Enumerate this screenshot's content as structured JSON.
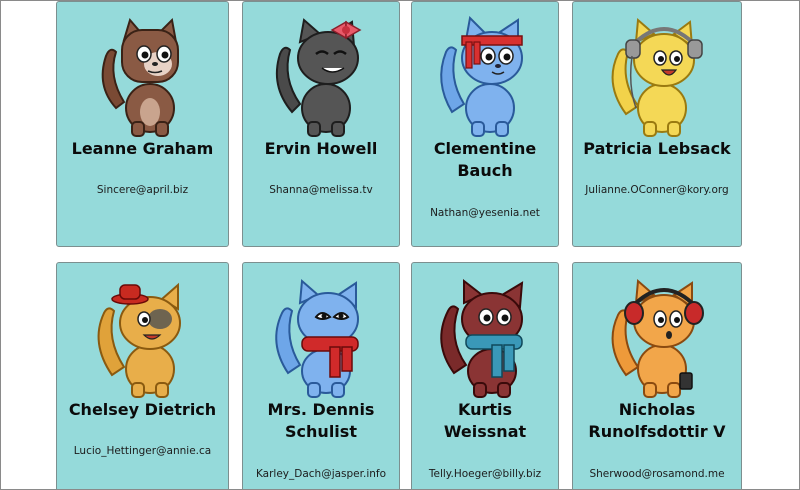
{
  "users": [
    {
      "name": "Leanne Graham",
      "email": "Sincere@april.biz",
      "avatar": "cat-brown-icon"
    },
    {
      "name": "Ervin Howell",
      "email": "Shanna@melissa.tv",
      "avatar": "cat-gray-bow-icon"
    },
    {
      "name": "Clementine Bauch",
      "email": "Nathan@yesenia.net",
      "avatar": "cat-blue-headband-icon"
    },
    {
      "name": "Patricia Lebsack",
      "email": "Julianne.OConner@kory.org",
      "avatar": "cat-yellow-headphones-icon"
    },
    {
      "name": "Chelsey Dietrich",
      "email": "Lucio_Hettinger@annie.ca",
      "avatar": "cat-orange-hat-icon"
    },
    {
      "name": "Mrs. Dennis Schulist",
      "email": "Karley_Dach@jasper.info",
      "avatar": "cat-blue-scarf-icon"
    },
    {
      "name": "Kurtis Weissnat",
      "email": "Telly.Hoeger@billy.biz",
      "avatar": "cat-maroon-scarf-icon"
    },
    {
      "name": "Nicholas Runolfsdottir V",
      "email": "Sherwood@rosamond.me",
      "avatar": "cat-orange-headphones-icon"
    }
  ],
  "colors": {
    "card_background": "#95dada",
    "card_border": "#7c8f8f",
    "page_background": "#ffffff"
  }
}
